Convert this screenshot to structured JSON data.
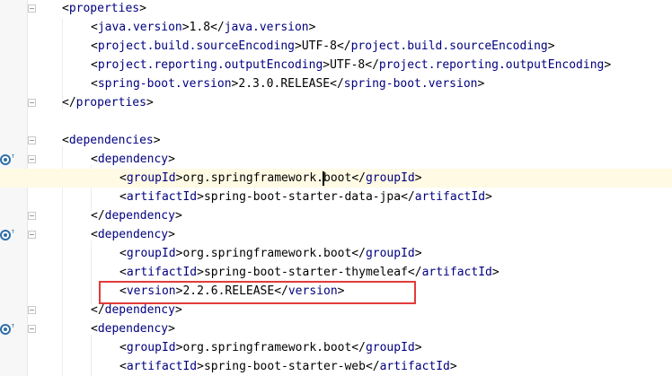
{
  "editor": {
    "lines": [
      {
        "indent": 0,
        "parts": [
          [
            "b",
            "<"
          ],
          [
            "t",
            "properties"
          ],
          [
            "b",
            ">"
          ]
        ]
      },
      {
        "indent": 1,
        "parts": [
          [
            "b",
            "<"
          ],
          [
            "t",
            "java.version"
          ],
          [
            "b",
            ">"
          ],
          [
            "x",
            "1.8"
          ],
          [
            "b",
            "</"
          ],
          [
            "t",
            "java.version"
          ],
          [
            "b",
            ">"
          ]
        ]
      },
      {
        "indent": 1,
        "parts": [
          [
            "b",
            "<"
          ],
          [
            "t",
            "project.build.sourceEncoding"
          ],
          [
            "b",
            ">"
          ],
          [
            "x",
            "UTF-8"
          ],
          [
            "b",
            "</"
          ],
          [
            "t",
            "project.build.sourceEncoding"
          ],
          [
            "b",
            ">"
          ]
        ]
      },
      {
        "indent": 1,
        "parts": [
          [
            "b",
            "<"
          ],
          [
            "t",
            "project.reporting.outputEncoding"
          ],
          [
            "b",
            ">"
          ],
          [
            "x",
            "UTF-8"
          ],
          [
            "b",
            "</"
          ],
          [
            "t",
            "project.reporting.outputEncoding"
          ],
          [
            "b",
            ">"
          ]
        ]
      },
      {
        "indent": 1,
        "parts": [
          [
            "b",
            "<"
          ],
          [
            "t",
            "spring-boot.version"
          ],
          [
            "b",
            ">"
          ],
          [
            "x",
            "2.3.0.RELEASE"
          ],
          [
            "b",
            "</"
          ],
          [
            "t",
            "spring-boot.version"
          ],
          [
            "b",
            ">"
          ]
        ]
      },
      {
        "indent": 0,
        "parts": [
          [
            "b",
            "</"
          ],
          [
            "t",
            "properties"
          ],
          [
            "b",
            ">"
          ]
        ]
      },
      {
        "indent": 0,
        "parts": []
      },
      {
        "indent": 0,
        "parts": [
          [
            "b",
            "<"
          ],
          [
            "t",
            "dependencies"
          ],
          [
            "b",
            ">"
          ]
        ]
      },
      {
        "indent": 1,
        "parts": [
          [
            "b",
            "<"
          ],
          [
            "t",
            "dependency"
          ],
          [
            "b",
            ">"
          ]
        ]
      },
      {
        "indent": 2,
        "parts": [
          [
            "b",
            "<"
          ],
          [
            "t",
            "groupId"
          ],
          [
            "b",
            ">"
          ],
          [
            "x",
            "org.springframework."
          ],
          [
            "c",
            ""
          ],
          [
            "x",
            "boot"
          ],
          [
            "b",
            "</"
          ],
          [
            "t",
            "groupId"
          ],
          [
            "b",
            ">"
          ]
        ],
        "current": true
      },
      {
        "indent": 2,
        "parts": [
          [
            "b",
            "<"
          ],
          [
            "t",
            "artifactId"
          ],
          [
            "b",
            ">"
          ],
          [
            "x",
            "spring-boot-starter-data-jpa"
          ],
          [
            "b",
            "</"
          ],
          [
            "t",
            "artifactId"
          ],
          [
            "b",
            ">"
          ]
        ]
      },
      {
        "indent": 1,
        "parts": [
          [
            "b",
            "</"
          ],
          [
            "t",
            "dependency"
          ],
          [
            "b",
            ">"
          ]
        ]
      },
      {
        "indent": 1,
        "parts": [
          [
            "b",
            "<"
          ],
          [
            "t",
            "dependency"
          ],
          [
            "b",
            ">"
          ]
        ]
      },
      {
        "indent": 2,
        "parts": [
          [
            "b",
            "<"
          ],
          [
            "t",
            "groupId"
          ],
          [
            "b",
            ">"
          ],
          [
            "x",
            "org.springframework.boot"
          ],
          [
            "b",
            "</"
          ],
          [
            "t",
            "groupId"
          ],
          [
            "b",
            ">"
          ]
        ]
      },
      {
        "indent": 2,
        "parts": [
          [
            "b",
            "<"
          ],
          [
            "t",
            "artifactId"
          ],
          [
            "b",
            ">"
          ],
          [
            "x",
            "spring-boot-starter-thymeleaf"
          ],
          [
            "b",
            "</"
          ],
          [
            "t",
            "artifactId"
          ],
          [
            "b",
            ">"
          ]
        ]
      },
      {
        "indent": 2,
        "parts": [
          [
            "b",
            "<"
          ],
          [
            "t",
            "version"
          ],
          [
            "b",
            ">"
          ],
          [
            "x",
            "2.2.6.RELEASE"
          ],
          [
            "b",
            "</"
          ],
          [
            "t",
            "version"
          ],
          [
            "b",
            ">"
          ]
        ]
      },
      {
        "indent": 1,
        "parts": [
          [
            "b",
            "</"
          ],
          [
            "t",
            "dependency"
          ],
          [
            "b",
            ">"
          ]
        ]
      },
      {
        "indent": 1,
        "parts": [
          [
            "b",
            "<"
          ],
          [
            "t",
            "dependency"
          ],
          [
            "b",
            ">"
          ]
        ]
      },
      {
        "indent": 2,
        "parts": [
          [
            "b",
            "<"
          ],
          [
            "t",
            "groupId"
          ],
          [
            "b",
            ">"
          ],
          [
            "x",
            "org.springframework.boot"
          ],
          [
            "b",
            "</"
          ],
          [
            "t",
            "groupId"
          ],
          [
            "b",
            ">"
          ]
        ]
      },
      {
        "indent": 2,
        "parts": [
          [
            "b",
            "<"
          ],
          [
            "t",
            "artifactId"
          ],
          [
            "b",
            ">"
          ],
          [
            "x",
            "spring-boot-starter-web"
          ],
          [
            "b",
            "</"
          ],
          [
            "t",
            "artifactId"
          ],
          [
            "b",
            ">"
          ]
        ]
      }
    ],
    "gutter_icons": [
      {
        "line": 8,
        "icon": "maven-dependency-icon"
      },
      {
        "line": 12,
        "icon": "maven-dependency-icon"
      },
      {
        "line": 17,
        "icon": "maven-dependency-icon"
      }
    ],
    "fold_lines": [
      0,
      5,
      7,
      8,
      11,
      12,
      16,
      17
    ],
    "highlight_line": 15,
    "colors": {
      "tag": "#000080",
      "text": "#000000",
      "highlight_box": "#e23b3b",
      "current_line": "#fffae3"
    }
  }
}
